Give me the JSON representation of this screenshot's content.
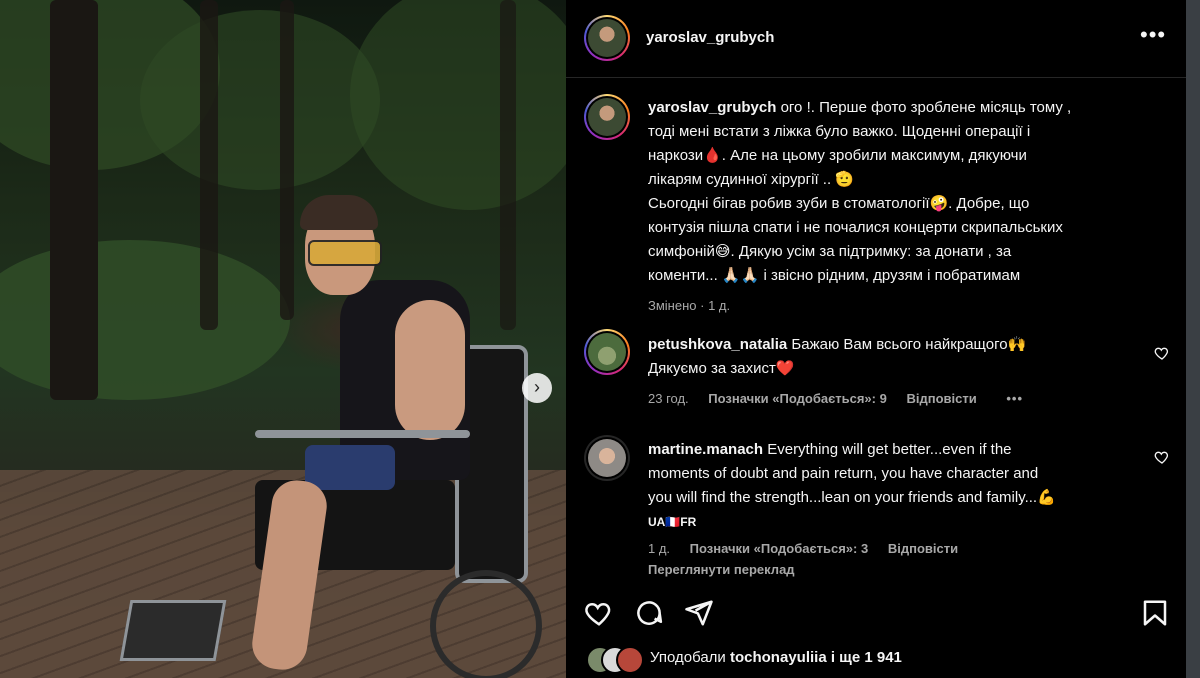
{
  "post": {
    "username": "yaroslav_grubych",
    "caption_username": "yaroslav_grubych",
    "caption_lines": [
      "ого !. Перше фото зроблене місяць тому ,",
      "тоді мені встати з ліжка було важко. Щоденні операції і",
      "наркози🩸. Але на цьому зробили максимум, дякуючи",
      "лікарям судинної хірургії .. 🫡",
      "Сьогодні бігав робив зуби в стоматології🤪. Добре, що",
      "контузія пішла спати і не почалися концерти скрипальських",
      "симфоній😅. Дякую усім за підтримку: за донати , за",
      "коменти... 🙏🏻🙏🏻 і звісно рідним, друзям і побратимам"
    ],
    "edited": "Змінено",
    "edited_time": "1 д.",
    "more_label": "•••"
  },
  "comments": [
    {
      "username": "petushkova_natalia",
      "lines": [
        "Бажаю Вам всього найкращого🙌",
        "Дякуємо за захист❤️"
      ],
      "time": "23 год.",
      "likes": "Позначки «Подобається»: 9",
      "reply": "Відповісти",
      "options": "•••"
    },
    {
      "username": "martine.manach",
      "lines": [
        "Everything will get better...even if the",
        "moments of doubt and pain return, you have character and",
        "you will find the strength...lean on your friends and family...💪",
        "UA🇫🇷FR"
      ],
      "time": "1 д.",
      "likes": "Позначки «Подобається»: 3",
      "reply": "Відповісти",
      "translate": "Переглянути переклад"
    }
  ],
  "likes_summary": {
    "prefix": "Уподобали",
    "user": "tochonayuliia",
    "suffix": "і ще 1 941"
  },
  "icons": [
    "like-icon",
    "comment-icon",
    "share-icon",
    "save-icon",
    "more-icon",
    "chevron-right-icon"
  ]
}
